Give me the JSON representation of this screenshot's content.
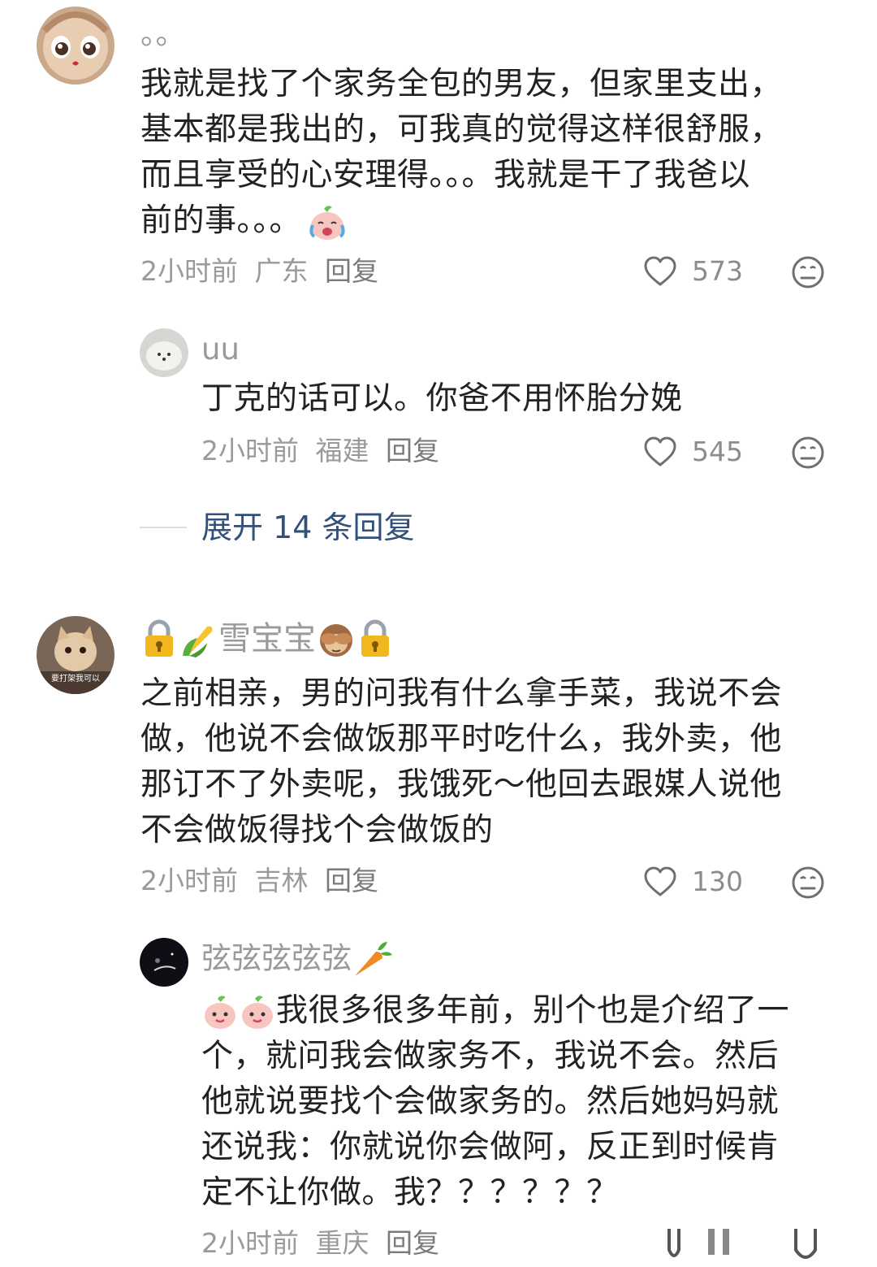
{
  "comments": [
    {
      "name": "。。",
      "text_lines": [
        "我就是找了个家务全包的男友，但家里支出，",
        "基本都是我出的，可我真的觉得这样很舒服，",
        "而且享受的心安理得。。。我就是干了我爸以",
        "前的事。。。"
      ],
      "time": "2小时前",
      "location": "广东",
      "reply_label": "回复",
      "likes": "573",
      "reply": {
        "name": "uu",
        "text": "丁克的话可以。你爸不用怀胎分娩",
        "time": "2小时前",
        "location": "福建",
        "reply_label": "回复",
        "likes": "545"
      },
      "expand_label": "展开 14 条回复"
    },
    {
      "name": "雪宝宝",
      "avatar_caption": "要打架我可以",
      "text_lines": [
        "之前相亲，男的问我有什么拿手菜，我说不会",
        "做，他说不会做饭那平时吃什么，我外卖，他",
        "那订不了外卖呢，我饿死～他回去跟媒人说他",
        "不会做饭得找个会做饭的"
      ],
      "time": "2小时前",
      "location": "吉林",
      "reply_label": "回复",
      "likes": "130",
      "reply": {
        "name": "弦弦弦弦弦",
        "text_first": "我很多很多年前，别个也是介绍了一",
        "text_lines": [
          "个，就问我会做家务不，我说不会。然后",
          "他就说要找个会做家务的。然后她妈妈就",
          "还说我：你就说你会做阿，反正到时候肯",
          "定不让你做。我？？？？？？"
        ],
        "time": "2小时前",
        "location": "重庆",
        "reply_label": "回复"
      }
    }
  ],
  "icons": {
    "like": "heart-outline-icon",
    "react": "neutral-face-icon",
    "lock": "lock-icon",
    "corn": "corn-icon",
    "carrot": "carrot-icon",
    "monkey": "see-no-evil-monkey-icon",
    "crying_peach": "crying-peach-emoji",
    "smiling_peach": "smiling-peach-emoji"
  },
  "colors": {
    "text": "#222222",
    "meta": "#9a9a9a",
    "expand_link": "#33507a"
  }
}
